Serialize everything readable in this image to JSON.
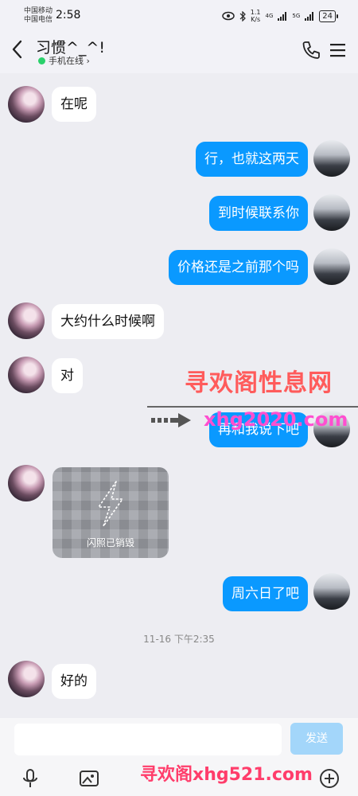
{
  "status_bar": {
    "carrier1": "中国移动",
    "carrier2": "中国电信",
    "time": "2:58",
    "net_speed_value": "1.1",
    "net_speed_unit": "K/s",
    "signal1": "4G",
    "signal2": "5G",
    "battery": "24"
  },
  "header": {
    "title": "习惯^_^!",
    "status": "手机在线 ›"
  },
  "messages": [
    {
      "side": "left",
      "text": "在呢"
    },
    {
      "side": "right",
      "text": "行，也就这两天"
    },
    {
      "side": "right",
      "text": "到时候联系你"
    },
    {
      "side": "right",
      "text": "价格还是之前那个吗"
    },
    {
      "side": "left",
      "text": "大约什么时候啊"
    },
    {
      "side": "left",
      "text": "对"
    },
    {
      "side": "right",
      "text": "再和我说下吧"
    },
    {
      "side": "left",
      "type": "flash",
      "text": "闪照已销毁"
    },
    {
      "side": "right",
      "text": "周六日了吧"
    },
    {
      "side": "left",
      "text": "好的"
    }
  ],
  "timestamp": "11-16 下午2:35",
  "input": {
    "placeholder": "",
    "send_label": "发送"
  },
  "watermarks": {
    "line1": "寻欢阁性息网",
    "line2": "xhg2020.com",
    "line3": "寻欢阁xhg521.com"
  },
  "colors": {
    "accent": "#0A99FF",
    "online": "#2BD16B",
    "send_disabled": "#A3D6FA"
  },
  "icons": [
    "back-icon",
    "phone-icon",
    "menu-icon",
    "mic-icon",
    "image-icon",
    "plus-icon"
  ]
}
